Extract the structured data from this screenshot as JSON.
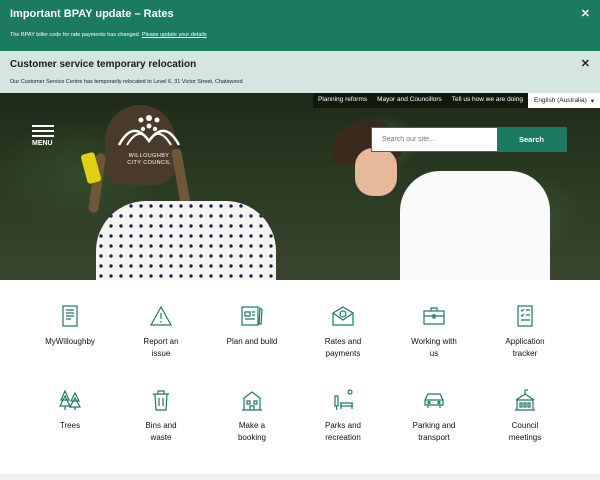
{
  "alerts": {
    "bpay": {
      "title": "Important BPAY update – Rates",
      "text": "The BPAY biller code for rate payments has changed.",
      "link": "Please update your details",
      "close": "✕"
    },
    "relocation": {
      "title": "Customer service temporary relocation",
      "text": "Our Customer Service Centre has temporarily relocated to Level 6, 31 Victor Street, Chatswood",
      "close": "✕"
    }
  },
  "topnav": {
    "links": [
      "Planning reforms",
      "Mayor and Councillors",
      "Tell us how we are doing"
    ],
    "language": "English (Australia)",
    "language_caret": "▾"
  },
  "header": {
    "menu_label": "MENU",
    "logo_line1": "WILLOUGHBY",
    "logo_line2": "CITY COUNCIL",
    "search_placeholder": "Search our site...",
    "search_button": "Search"
  },
  "services": [
    {
      "label": "MyWilloughby",
      "icon": "document-icon"
    },
    {
      "label": "Report an issue",
      "icon": "warning-icon"
    },
    {
      "label": "Plan and build",
      "icon": "plan-icon"
    },
    {
      "label": "Rates and payments",
      "icon": "envelope-dollar-icon"
    },
    {
      "label": "Working with us",
      "icon": "briefcase-icon"
    },
    {
      "label": "Application tracker",
      "icon": "checklist-icon"
    },
    {
      "label": "Trees",
      "icon": "trees-icon"
    },
    {
      "label": "Bins and waste",
      "icon": "bin-icon"
    },
    {
      "label": "Make a booking",
      "icon": "building-icon"
    },
    {
      "label": "Parks and recreation",
      "icon": "park-bench-icon"
    },
    {
      "label": "Parking and transport",
      "icon": "car-icon"
    },
    {
      "label": "Council meetings",
      "icon": "council-building-icon"
    }
  ],
  "colors": {
    "brand": "#1c7a60",
    "alert_light": "#d4e6df"
  }
}
